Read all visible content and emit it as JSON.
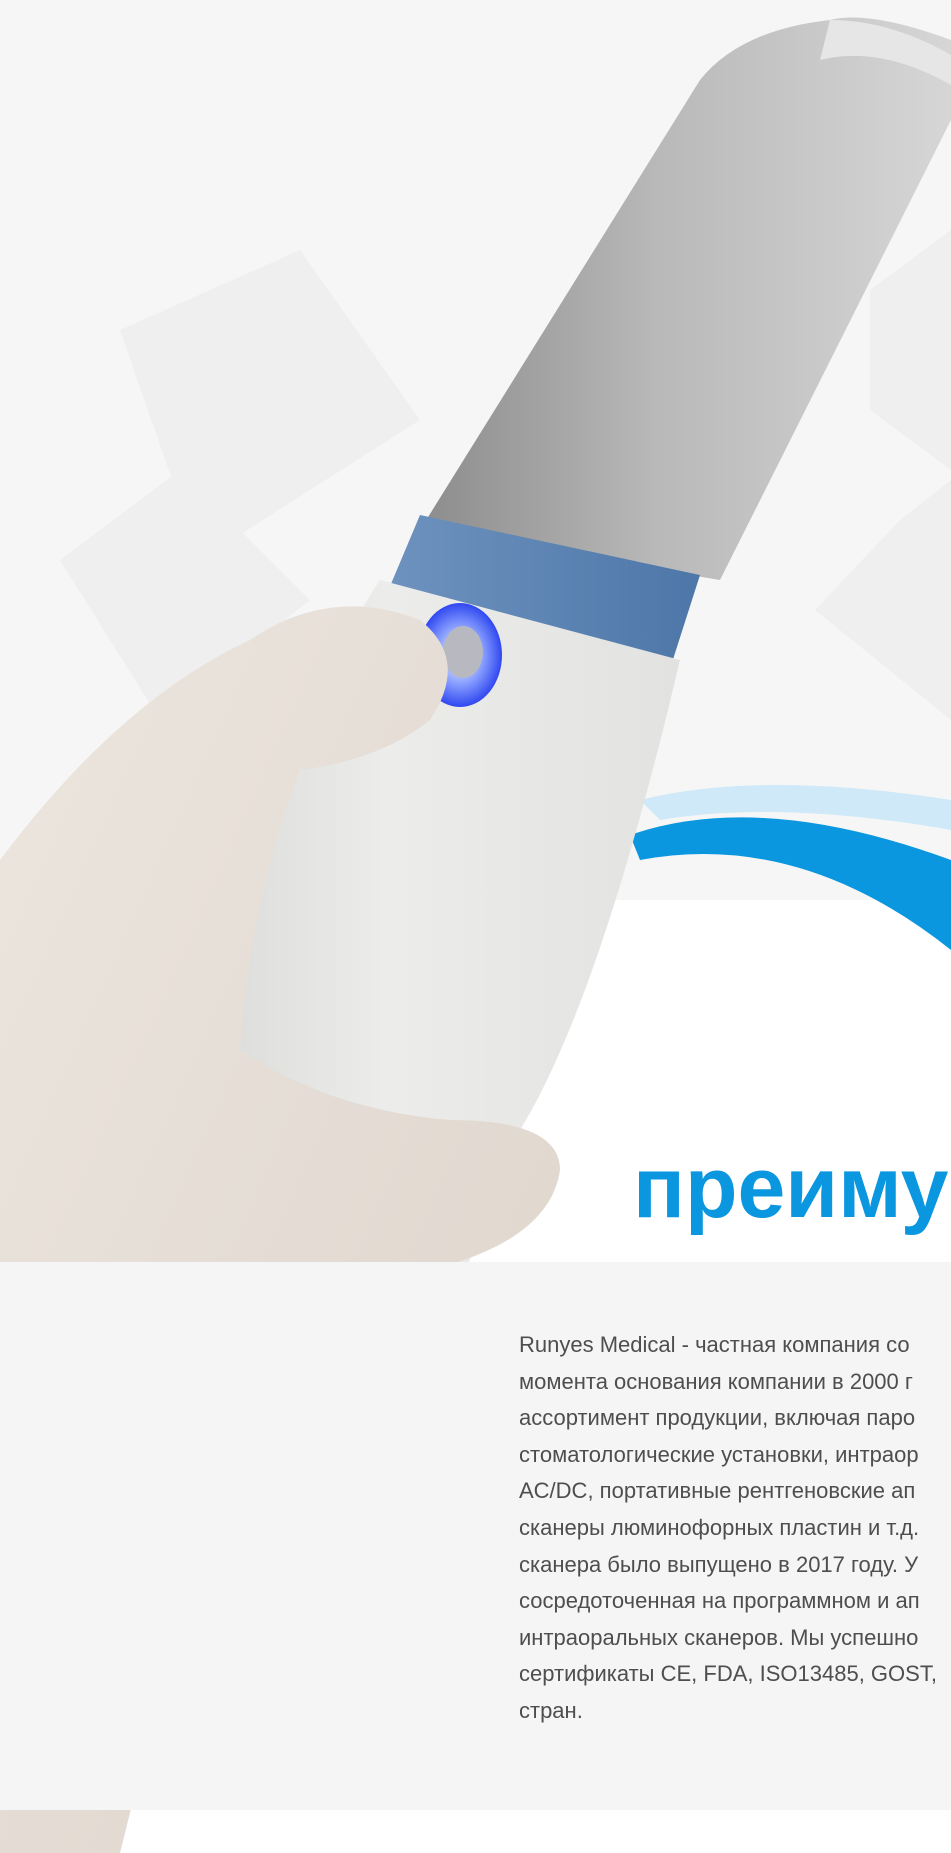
{
  "section": {
    "heading": "преиму",
    "body_lines": [
      "Runyes Medical - частная компания со",
      "момента основания компании в 2000 г",
      "ассортимент продукции, включая паро",
      "стоматологические установки, интраор",
      "AC/DC, портативные рентгеновские ап",
      "сканеры люминофорных пластин и т.д.",
      "сканера было выпущено в 2017 году. У",
      "сосредоточенная на программном и ап",
      "интраоральных сканеров. Мы успешно",
      "сертификаты CE, FDA, ISO13485, GOST,",
      "стран."
    ]
  },
  "colors": {
    "accent": "#0a97e0",
    "light_accent": "#cfe9f8",
    "scanner_band": "#5a82b0",
    "button_glow": "#4a66ff",
    "background": "#f6f6f6"
  },
  "icons": {
    "product": "intraoral-scanner-image",
    "hand": "hand-holding-scanner"
  }
}
